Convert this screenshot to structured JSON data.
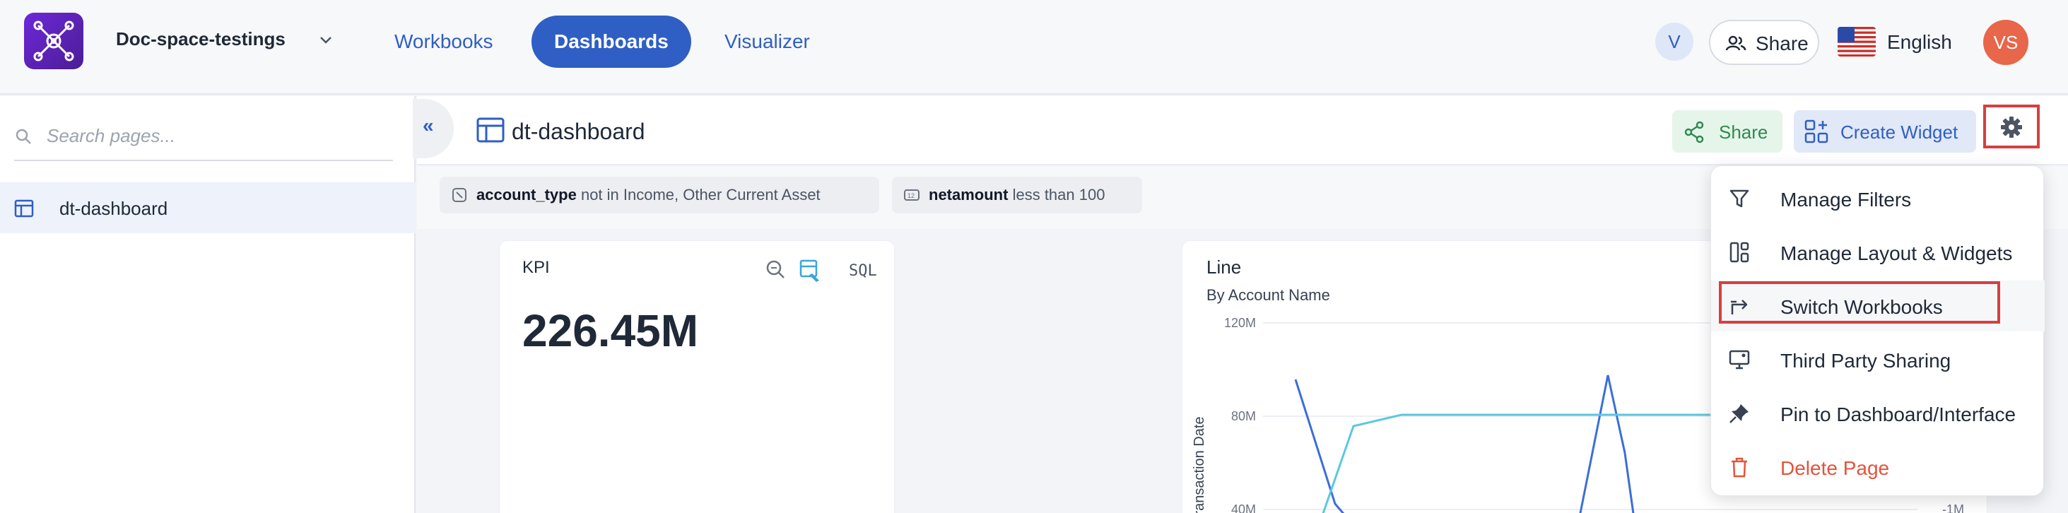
{
  "topbar": {
    "workspace_name": "Doc-space-testings",
    "nav": [
      "Workbooks",
      "Dashboards",
      "Visualizer"
    ],
    "active_nav": "Dashboards",
    "user_badge": "V",
    "share_label": "Share",
    "language": "English",
    "avatar_initials": "VS"
  },
  "sidebar": {
    "search_placeholder": "Search pages...",
    "items": [
      {
        "label": "dt-dashboard"
      }
    ]
  },
  "header": {
    "collapse_glyph": "«",
    "title": "dt-dashboard",
    "share_label": "Share",
    "create_widget_label": "Create Widget"
  },
  "filters": [
    {
      "field": "account_type",
      "condition": "not in Income, Other Current Asset"
    },
    {
      "field": "netamount",
      "condition": "less than 100"
    }
  ],
  "kpi": {
    "title": "KPI",
    "sql_label": "SQL",
    "value": "226.45M"
  },
  "line_chart": {
    "title": "Line",
    "subtitle": "By Account Name",
    "y_ticks": [
      "120M",
      "80M",
      "40M"
    ],
    "y_axis_label": "Transaction Date",
    "right_tick": "-1M"
  },
  "menu": {
    "items": [
      {
        "label": "Manage Filters",
        "icon": "filter-icon"
      },
      {
        "label": "Manage Layout & Widgets",
        "icon": "layout-icon"
      },
      {
        "label": "Switch Workbooks",
        "icon": "switch-icon"
      },
      {
        "label": "Third Party Sharing",
        "icon": "monitor-share-icon"
      },
      {
        "label": "Pin to Dashboard/Interface",
        "icon": "pin-icon"
      },
      {
        "label": "Delete Page",
        "icon": "trash-icon"
      }
    ]
  },
  "colors": {
    "accent": "#2f5fc4",
    "danger": "#e5533b",
    "highlight_box": "#d64040",
    "line_series_1": "#3b6ed8",
    "line_series_2": "#5bc8e0"
  }
}
